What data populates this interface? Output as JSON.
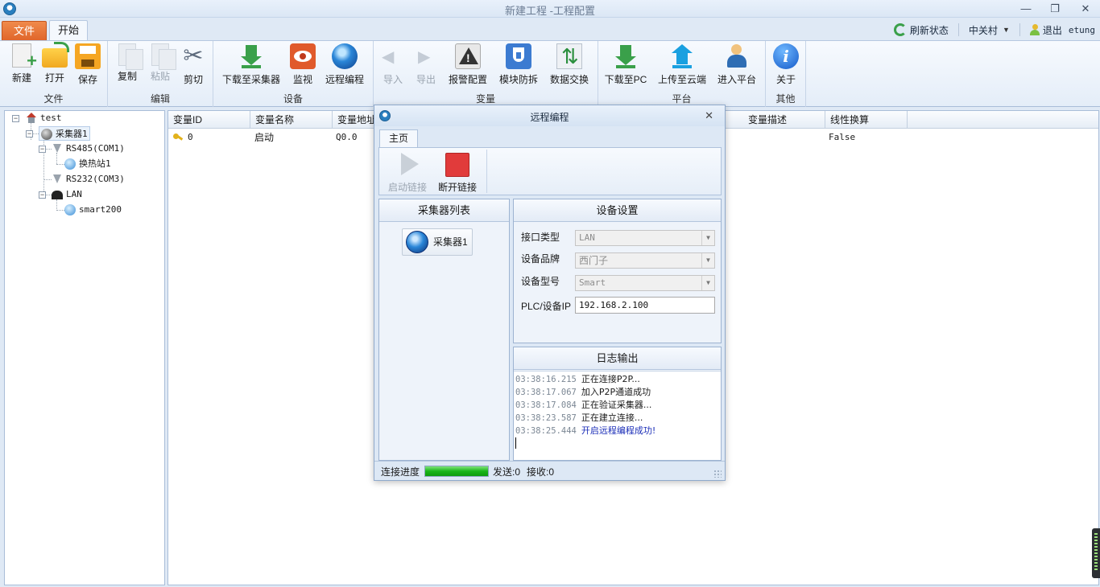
{
  "window": {
    "title": "新建工程 -工程配置"
  },
  "tabs": {
    "file": "文件",
    "start": "开始"
  },
  "status_bar": {
    "refresh": "刷新状态",
    "location": "中关村",
    "logout": "退出",
    "user": "etung"
  },
  "ribbon": {
    "groups": {
      "file": "文件",
      "edit": "编辑",
      "device": "设备",
      "variable": "变量",
      "platform": "平台",
      "other": "其他"
    },
    "buttons": {
      "new": "新建",
      "open": "打开",
      "save": "保存",
      "copy": "复制",
      "paste": "粘贴",
      "cut": "剪切",
      "download_to_collector": "下载至采集器",
      "monitor": "监视",
      "remote_programming": "远程编程",
      "import": "导入",
      "export": "导出",
      "alarm_config": "报警配置",
      "module_anti_tamper": "模块防拆",
      "data_exchange": "数据交换",
      "download_to_pc": "下载至PC",
      "upload_to_cloud": "上传至云端",
      "enter_platform": "进入平台",
      "about": "关于"
    }
  },
  "tree": {
    "root": "test",
    "collector": "采集器1",
    "rs485": "RS485(COM1)",
    "station": "换热站1",
    "rs232": "RS232(COM3)",
    "lan": "LAN",
    "smart200": "smart200"
  },
  "grid": {
    "columns": [
      "变量ID",
      "变量名称",
      "变量地址",
      "变量描述",
      "线性换算"
    ],
    "rows": [
      {
        "id": "0",
        "name": "启动",
        "address": "Q0.0",
        "linear": "False"
      }
    ]
  },
  "dialog": {
    "title": "远程编程",
    "tab": "主页",
    "start_link": "启动链接",
    "stop_link": "断开链接",
    "collector_list_title": "采集器列表",
    "collector_item": "采集器1",
    "device_settings_title": "设备设置",
    "interface_type_label": "接口类型",
    "interface_type_value": "LAN",
    "brand_label": "设备品牌",
    "brand_value": "西门子",
    "model_label": "设备型号",
    "model_value": "Smart",
    "ip_label": "PLC/设备IP",
    "ip_value": "192.168.2.100",
    "log_title": "日志输出",
    "logs": [
      {
        "time": "03:38:16.215",
        "msg": "正在连接P2P..."
      },
      {
        "time": "03:38:17.067",
        "msg": "加入P2P通道成功"
      },
      {
        "time": "03:38:17.084",
        "msg": "正在验证采集器..."
      },
      {
        "time": "03:38:23.587",
        "msg": "正在建立连接..."
      },
      {
        "time": "03:38:25.444",
        "msg": "开启远程编程成功!"
      }
    ],
    "progress_label": "连接进度",
    "progress": 1.0,
    "sent": "发送:0",
    "received": "接收:0"
  },
  "colors": {
    "file_tab": "#e0662b",
    "accent": "#2a7fbf",
    "progress": "#19b519",
    "log_success": "#1c2fb8"
  }
}
